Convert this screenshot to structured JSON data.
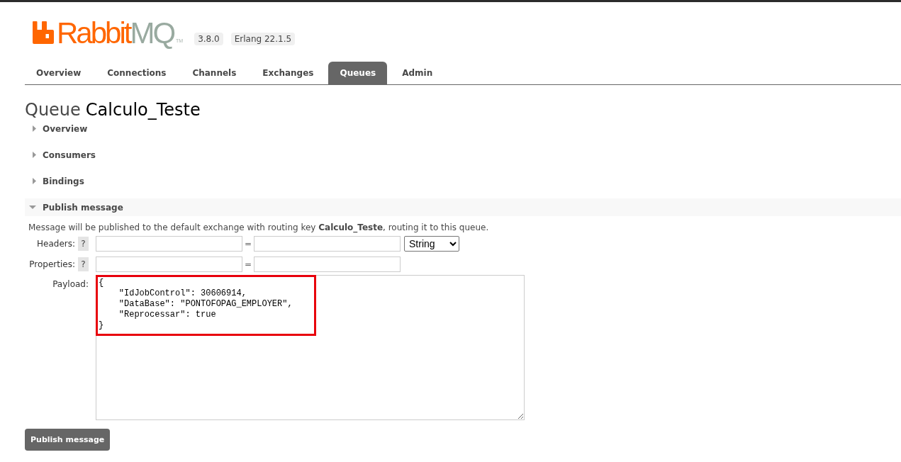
{
  "header": {
    "logo": {
      "brand": "Rabbit",
      "product": "MQ",
      "trademark": "TM"
    },
    "badges": [
      "3.8.0",
      "Erlang 22.1.5"
    ]
  },
  "tabs": [
    {
      "label": "Overview",
      "selected": false
    },
    {
      "label": "Connections",
      "selected": false
    },
    {
      "label": "Channels",
      "selected": false
    },
    {
      "label": "Exchanges",
      "selected": false
    },
    {
      "label": "Queues",
      "selected": true
    },
    {
      "label": "Admin",
      "selected": false
    }
  ],
  "page_title": {
    "prefix": "Queue",
    "name": "Calculo_Teste"
  },
  "sections": [
    {
      "label": "Overview",
      "expanded": false
    },
    {
      "label": "Consumers",
      "expanded": false
    },
    {
      "label": "Bindings",
      "expanded": false
    },
    {
      "label": "Publish message",
      "expanded": true,
      "content": {
        "description": "Message will be published to the default exchange with routing key **Calculo_Teste**, routing it to this queue.",
        "rows": [
          {
            "kind": "pair",
            "label": "Headers:",
            "help": "?",
            "separator": "=",
            "type_select": "String"
          },
          {
            "kind": "pair",
            "label": "Properties:",
            "help": "?",
            "separator": "="
          },
          {
            "kind": "text",
            "label": "Payload:",
            "value": "{\n    \"IdJobControl\": 30606914,\n    \"DataBase\": \"PONTOFOPAG_EMPLOYER\",\n    \"Reprocessar\": true\n}"
          }
        ],
        "submit": "Publish message"
      }
    }
  ]
}
